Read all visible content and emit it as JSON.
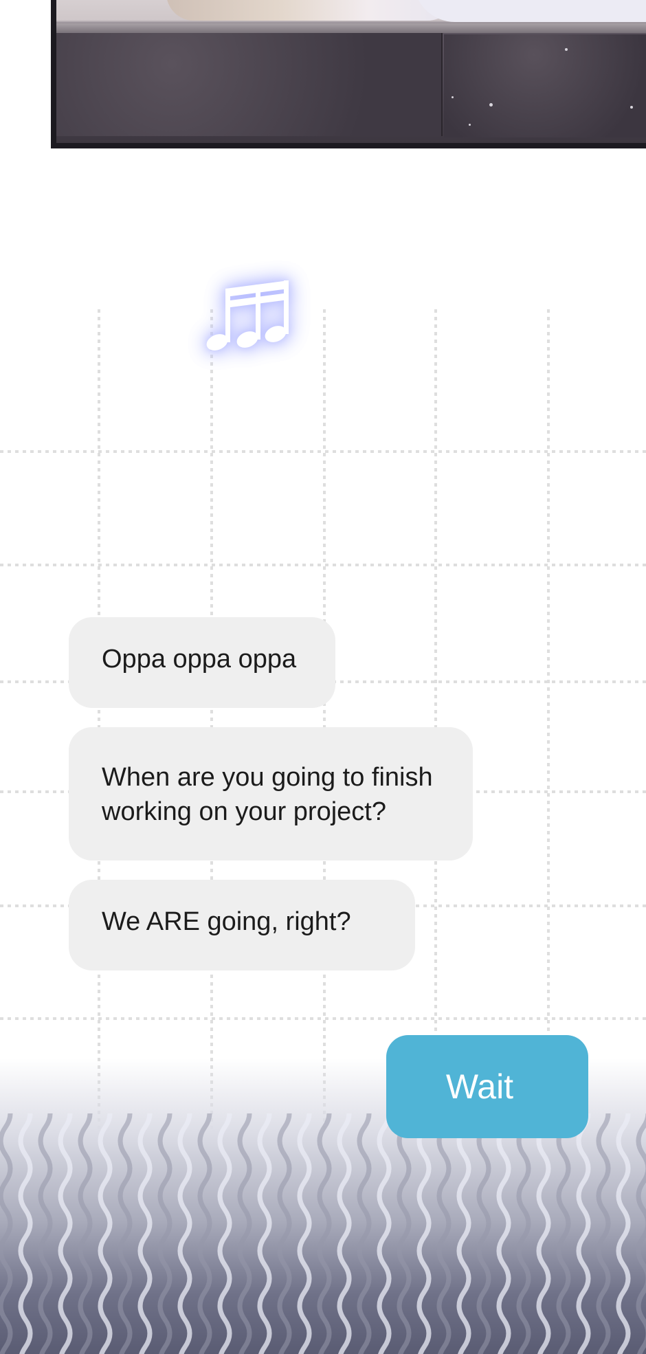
{
  "messages": [
    {
      "text_lines": [
        "Oppa oppa oppa"
      ]
    },
    {
      "text_lines": [
        "When are you going to finish",
        "working on your project?"
      ]
    },
    {
      "text_lines": [
        "We ARE going, right?"
      ]
    }
  ],
  "reply_button": {
    "label": "Wait",
    "color": "#50b4d6"
  },
  "bubble_color": "#efefef",
  "icons": {
    "music": "music-notes-icon"
  }
}
